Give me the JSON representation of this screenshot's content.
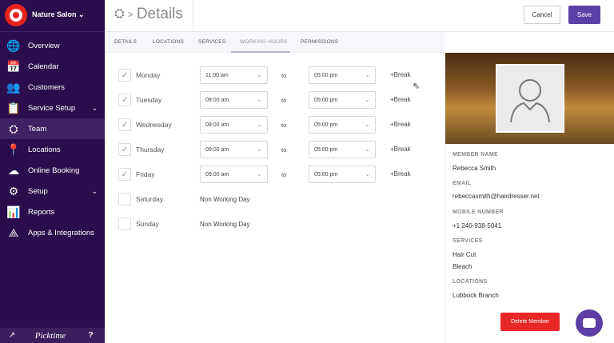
{
  "sidebar": {
    "salon": "Nature Salon",
    "items": [
      {
        "label": "Overview",
        "icon": "globe-icon",
        "glyph": "🌐"
      },
      {
        "label": "Calendar",
        "icon": "calendar-icon",
        "glyph": "📅"
      },
      {
        "label": "Customers",
        "icon": "customers-icon",
        "glyph": "👥"
      },
      {
        "label": "Service Setup",
        "icon": "service-icon",
        "glyph": "📋",
        "chevron": true
      },
      {
        "label": "Team",
        "icon": "team-icon",
        "glyph": "⛭",
        "active": true
      },
      {
        "label": "Locations",
        "icon": "location-icon",
        "glyph": "📍"
      },
      {
        "label": "Online Booking",
        "icon": "cloud-icon",
        "glyph": "☁"
      },
      {
        "label": "Setup",
        "icon": "gear-icon",
        "glyph": "⚙",
        "chevron": true
      },
      {
        "label": "Reports",
        "icon": "reports-icon",
        "glyph": "📊"
      },
      {
        "label": "Apps & Integrations",
        "icon": "apps-icon",
        "glyph": "⟁"
      }
    ],
    "footer": {
      "brand": "Picktime",
      "help": "?"
    }
  },
  "header": {
    "title": "Details",
    "separator": ">",
    "cancel": "Cancel",
    "save": "Save"
  },
  "tabs": [
    "DETAILS",
    "LOCATIONS",
    "SERVICES",
    "WORKING HOURS",
    "PERMISSIONS"
  ],
  "active_tab": "WORKING HOURS",
  "hours": [
    {
      "day": "Monday",
      "checked": true,
      "start": "11:00 am",
      "end": "05:00 pm"
    },
    {
      "day": "Tuesday",
      "checked": true,
      "start": "09:00 am",
      "end": "05:00 pm"
    },
    {
      "day": "Wednesday",
      "checked": true,
      "start": "09:00 am",
      "end": "05:00 pm"
    },
    {
      "day": "Thursday",
      "checked": true,
      "start": "09:00 am",
      "end": "05:00 pm"
    },
    {
      "day": "Friday",
      "checked": true,
      "start": "09:00 am",
      "end": "05:00 pm"
    },
    {
      "day": "Saturday",
      "checked": false,
      "note": "Non Working Day"
    },
    {
      "day": "Sunday",
      "checked": false,
      "note": "Non Working Day"
    }
  ],
  "to_label": "to",
  "break_label": "+Break",
  "member": {
    "name_label": "MEMBER NAME",
    "name": "Rebecca Smith",
    "email_label": "EMAIL",
    "email": "rebeccasmith@hairdresser.net",
    "mobile_label": "MOBILE NUMBER",
    "mobile": "+1 240-938-5041",
    "services_label": "SERVICES",
    "services": [
      "Hair Cut",
      "Bleach"
    ],
    "locations_label": "LOCATIONS",
    "locations": [
      "Lubbock Branch"
    ],
    "delete": "Delete Member"
  },
  "colors": {
    "sidebar": "#2b0d4e",
    "accent": "#5d3ea5",
    "danger": "#e82828"
  }
}
